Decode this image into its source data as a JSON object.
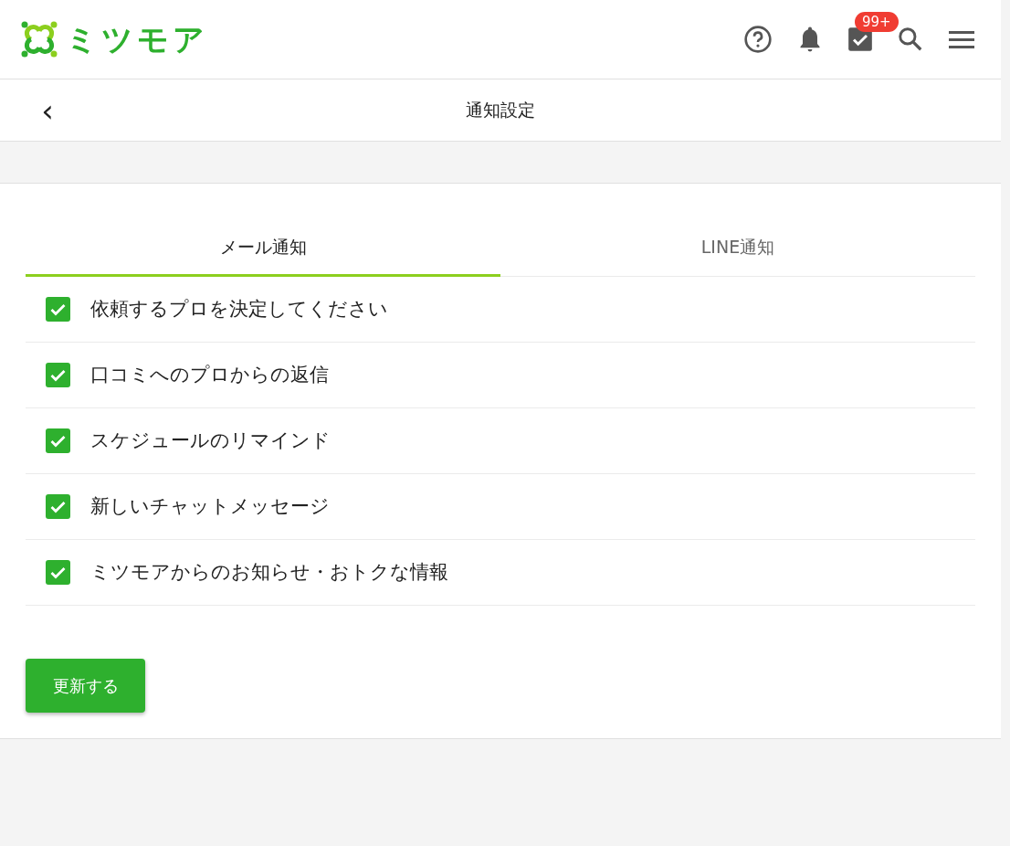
{
  "header": {
    "logo_text": "ミツモア",
    "badge": "99+"
  },
  "title_bar": {
    "back": "‹",
    "title": "通知設定"
  },
  "tabs": [
    {
      "label": "メール通知",
      "selected": true
    },
    {
      "label": "LINE通知",
      "selected": false
    }
  ],
  "settings": [
    {
      "label": "依頼するプロを決定してください",
      "checked": true
    },
    {
      "label": "口コミへのプロからの返信",
      "checked": true
    },
    {
      "label": "スケジュールのリマインド",
      "checked": true
    },
    {
      "label": "新しいチャットメッセージ",
      "checked": true
    },
    {
      "label": "ミツモアからのお知らせ・おトクな情報",
      "checked": true
    }
  ],
  "submit_button": "更新する"
}
